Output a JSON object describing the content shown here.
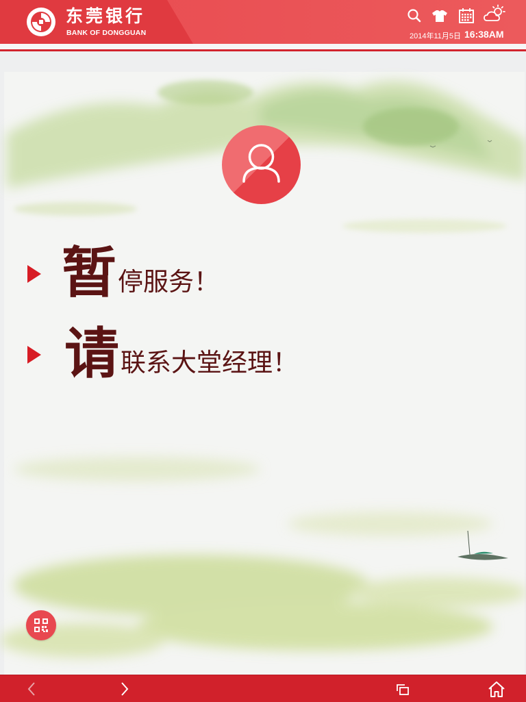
{
  "header": {
    "bank_name_cn": "东莞银行",
    "bank_name_en": "BANK OF DONGGUAN",
    "date": "2014年11月5日",
    "time": "16:38AM",
    "icons": [
      "search-icon",
      "shirt-icon",
      "calendar-icon",
      "weather-cloudy-sun-icon"
    ]
  },
  "main": {
    "avatar_icon": "user-icon",
    "messages": [
      {
        "big": "暂",
        "rest": "停服务！"
      },
      {
        "big": "请",
        "rest": "联系大堂经理！"
      }
    ],
    "qr_icon": "qr-code-icon"
  },
  "footer": {
    "buttons": [
      "back-arrow-icon",
      "forward-arrow-icon",
      "windows-icon",
      "home-icon"
    ]
  },
  "colors": {
    "header_red": "#e84a4f",
    "accent_red": "#d71c24",
    "text_maroon": "#5b1414",
    "footer_red": "#d1212b"
  }
}
